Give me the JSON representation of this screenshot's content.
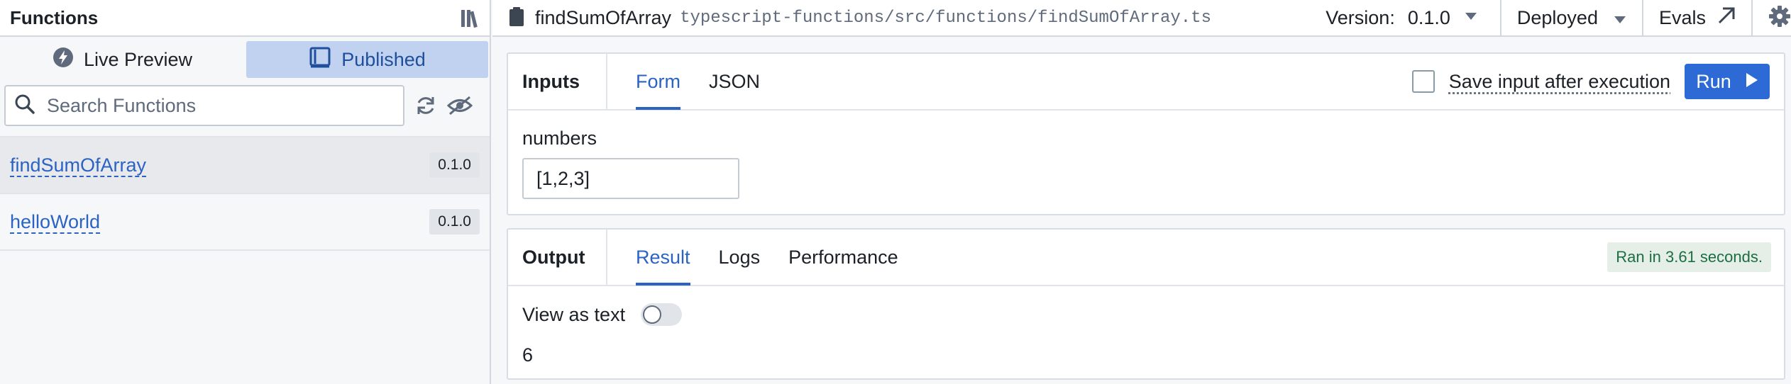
{
  "sidebar": {
    "title": "Functions",
    "modes": [
      {
        "label": "Live Preview",
        "active": false
      },
      {
        "label": "Published",
        "active": true
      }
    ],
    "search_placeholder": "Search Functions",
    "functions": [
      {
        "name": "findSumOfArray",
        "version": "0.1.0",
        "selected": true
      },
      {
        "name": "helloWorld",
        "version": "0.1.0",
        "selected": false
      }
    ]
  },
  "topbar": {
    "file_name": "findSumOfArray",
    "file_path": "typescript-functions/src/functions/findSumOfArray.ts",
    "version_label": "Version:",
    "version_value": "0.1.0",
    "deploy_status": "Deployed",
    "evals_label": "Evals"
  },
  "inputs": {
    "title": "Inputs",
    "tabs": [
      {
        "label": "Form",
        "active": true
      },
      {
        "label": "JSON",
        "active": false
      }
    ],
    "save_label": "Save input after execution",
    "run_label": "Run",
    "field_label": "numbers",
    "field_value": "[1,2,3]"
  },
  "output": {
    "title": "Output",
    "tabs": [
      {
        "label": "Result",
        "active": true
      },
      {
        "label": "Logs",
        "active": false
      },
      {
        "label": "Performance",
        "active": false
      }
    ],
    "ran_text": "Ran in 3.61 seconds.",
    "view_as_text_label": "View as text",
    "result_value": "6"
  },
  "colors": {
    "accent": "#2d6ad6",
    "success_bg": "#e5efe7",
    "success_text": "#1c6e42"
  }
}
